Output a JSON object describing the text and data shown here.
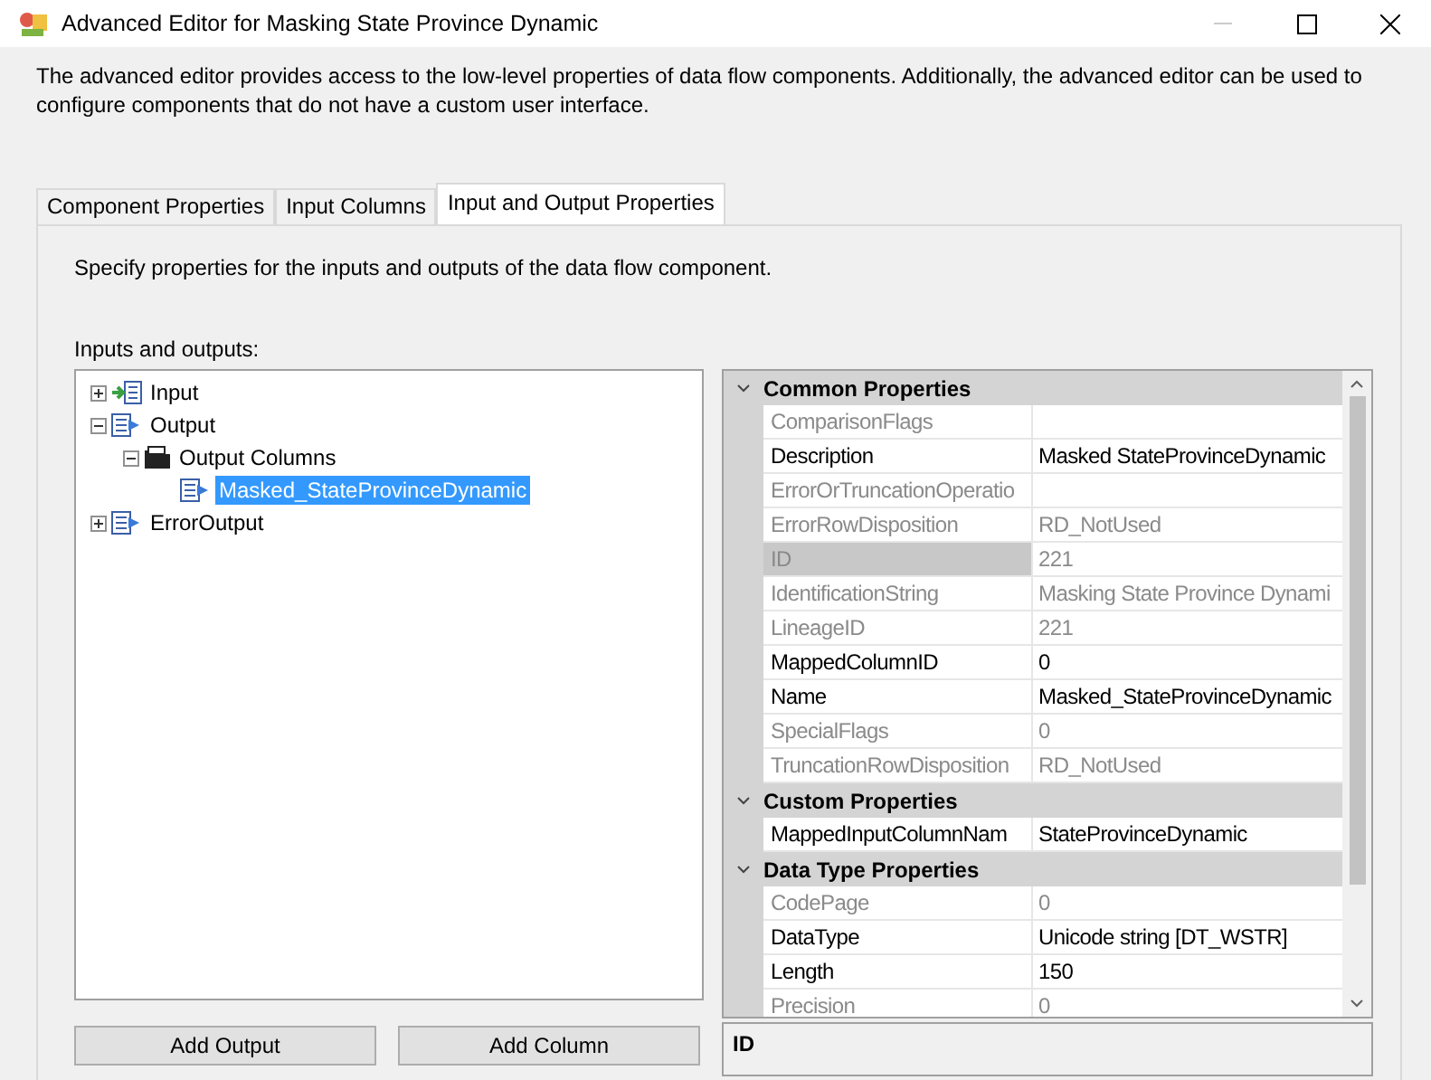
{
  "window": {
    "title": "Advanced Editor for Masking State Province Dynamic"
  },
  "intro": "The advanced editor provides access to the low-level properties of data flow components. Additionally, the advanced editor can be used to configure components that do not have a custom user interface.",
  "tabs": [
    {
      "label": "Component Properties",
      "selected": false
    },
    {
      "label": "Input Columns",
      "selected": false
    },
    {
      "label": "Input and Output Properties",
      "selected": true
    }
  ],
  "panel_hint": "Specify properties for the inputs and outputs of the data flow component.",
  "tree_label": "Inputs and outputs:",
  "tree": [
    {
      "label": "Input",
      "kind": "input",
      "expanded": false,
      "selected": false
    },
    {
      "label": "Output",
      "kind": "output",
      "expanded": true,
      "selected": false,
      "children": [
        {
          "label": "Output Columns",
          "kind": "folder",
          "expanded": true,
          "selected": false,
          "children": [
            {
              "label": "Masked_StateProvinceDynamic",
              "kind": "column",
              "selected": true
            }
          ]
        }
      ]
    },
    {
      "label": "ErrorOutput",
      "kind": "output",
      "expanded": false,
      "selected": false
    }
  ],
  "property_grid": [
    {
      "category": "Common Properties",
      "expanded": true,
      "rows": [
        {
          "name": "ComparisonFlags",
          "value": "",
          "readonly": true,
          "selected": false
        },
        {
          "name": "Description",
          "value": "Masked StateProvinceDynamic",
          "readonly": false,
          "selected": false
        },
        {
          "name": "ErrorOrTruncationOperatio",
          "value": "",
          "readonly": true,
          "selected": false
        },
        {
          "name": "ErrorRowDisposition",
          "value": "RD_NotUsed",
          "readonly": true,
          "selected": false
        },
        {
          "name": "ID",
          "value": "221",
          "readonly": true,
          "selected": true
        },
        {
          "name": "IdentificationString",
          "value": "Masking State Province Dynami",
          "readonly": true,
          "selected": false
        },
        {
          "name": "LineageID",
          "value": "221",
          "readonly": true,
          "selected": false
        },
        {
          "name": "MappedColumnID",
          "value": "0",
          "readonly": false,
          "selected": false
        },
        {
          "name": "Name",
          "value": "Masked_StateProvinceDynamic",
          "readonly": false,
          "selected": false
        },
        {
          "name": "SpecialFlags",
          "value": "0",
          "readonly": true,
          "selected": false
        },
        {
          "name": "TruncationRowDisposition",
          "value": "RD_NotUsed",
          "readonly": true,
          "selected": false
        }
      ]
    },
    {
      "category": "Custom Properties",
      "expanded": true,
      "rows": [
        {
          "name": "MappedInputColumnNam",
          "value": "StateProvinceDynamic",
          "readonly": false,
          "selected": false
        }
      ]
    },
    {
      "category": "Data Type Properties",
      "expanded": true,
      "rows": [
        {
          "name": "CodePage",
          "value": "0",
          "readonly": true,
          "selected": false
        },
        {
          "name": "DataType",
          "value": "Unicode string [DT_WSTR]",
          "readonly": false,
          "selected": false
        },
        {
          "name": "Length",
          "value": "150",
          "readonly": false,
          "selected": false
        },
        {
          "name": "Precision",
          "value": "0",
          "readonly": true,
          "selected": false
        }
      ]
    }
  ],
  "property_description": {
    "title": "ID"
  },
  "buttons": [
    "Add Output",
    "Add Column"
  ]
}
